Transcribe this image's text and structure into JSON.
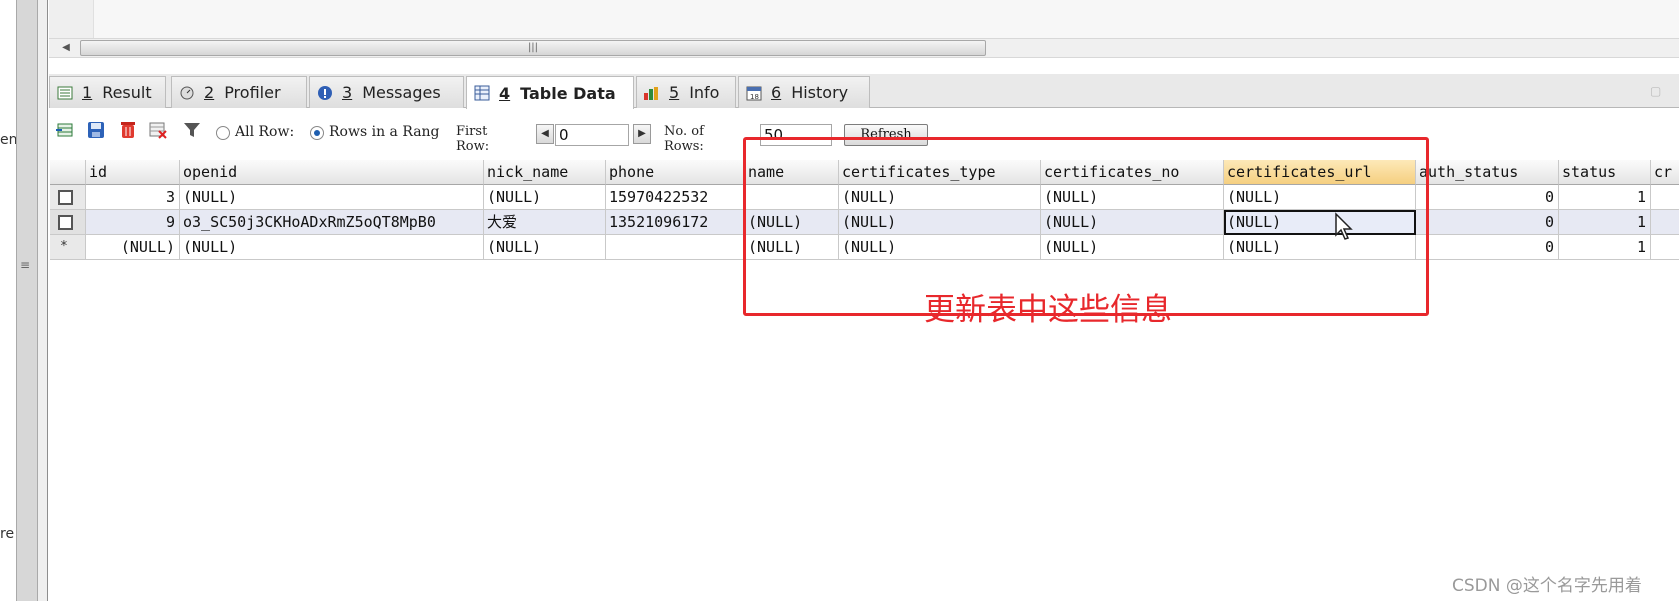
{
  "left_edge": {
    "top_text": "en",
    "bottom_text": "re",
    "grip": "≡"
  },
  "hscroll": {
    "left_arrow": "◀",
    "thumb_grip": "|||"
  },
  "tabs": [
    {
      "icon": "result-icon",
      "num": "1",
      "label": "Result",
      "active": false
    },
    {
      "icon": "profiler-icon",
      "num": "2",
      "label": "Profiler",
      "active": false
    },
    {
      "icon": "messages-icon",
      "num": "3",
      "label": "Messages",
      "active": false
    },
    {
      "icon": "table-data-icon",
      "num": "4",
      "label": "Table Data",
      "active": true
    },
    {
      "icon": "info-icon",
      "num": "5",
      "label": "Info",
      "active": false
    },
    {
      "icon": "history-icon",
      "num": "6",
      "label": "History",
      "active": false
    }
  ],
  "toolbar": {
    "icons": [
      "insert-row-icon",
      "save-icon",
      "delete-icon",
      "cancel-changes-icon",
      "filter-icon"
    ],
    "all_rows_label": "All Row:",
    "rows_in_range_label": "Rows in a Rang",
    "first_row_label": "First Row:",
    "first_row_value": "0",
    "no_of_rows_label": "No. of Rows:",
    "no_of_rows_value": "50",
    "refresh_label": "Refresh",
    "prev": "◀",
    "next": "▶",
    "rows_in_range_selected": true
  },
  "grid": {
    "columns": [
      "id",
      "openid",
      "nick_name",
      "phone",
      "name",
      "certificates_type",
      "certificates_no",
      "certificates_url",
      "auth_status",
      "status",
      "cr"
    ],
    "highlighted_column": "certificates_url",
    "rows": [
      {
        "marker": "",
        "cells": [
          "3",
          "(NULL)",
          "(NULL)",
          "15970422532",
          "",
          "(NULL)",
          "(NULL)",
          "(NULL)",
          "0",
          "1",
          ""
        ]
      },
      {
        "marker": "",
        "cells": [
          "9",
          "o3_SC50j3CKHoADxRmZ5oQT8MpB0",
          "大爱",
          "13521096172",
          "(NULL)",
          "(NULL)",
          "(NULL)",
          "(NULL)",
          "0",
          "1",
          ""
        ]
      },
      {
        "marker": "*",
        "cells": [
          "(NULL)",
          "(NULL)",
          "(NULL)",
          "",
          "(NULL)",
          "(NULL)",
          "(NULL)",
          "(NULL)",
          "0",
          "1",
          ""
        ]
      }
    ]
  },
  "annotation": {
    "text": "更新表中这些信息",
    "color": "#e8282c"
  },
  "watermark": "CSDN @这个名字先用着"
}
